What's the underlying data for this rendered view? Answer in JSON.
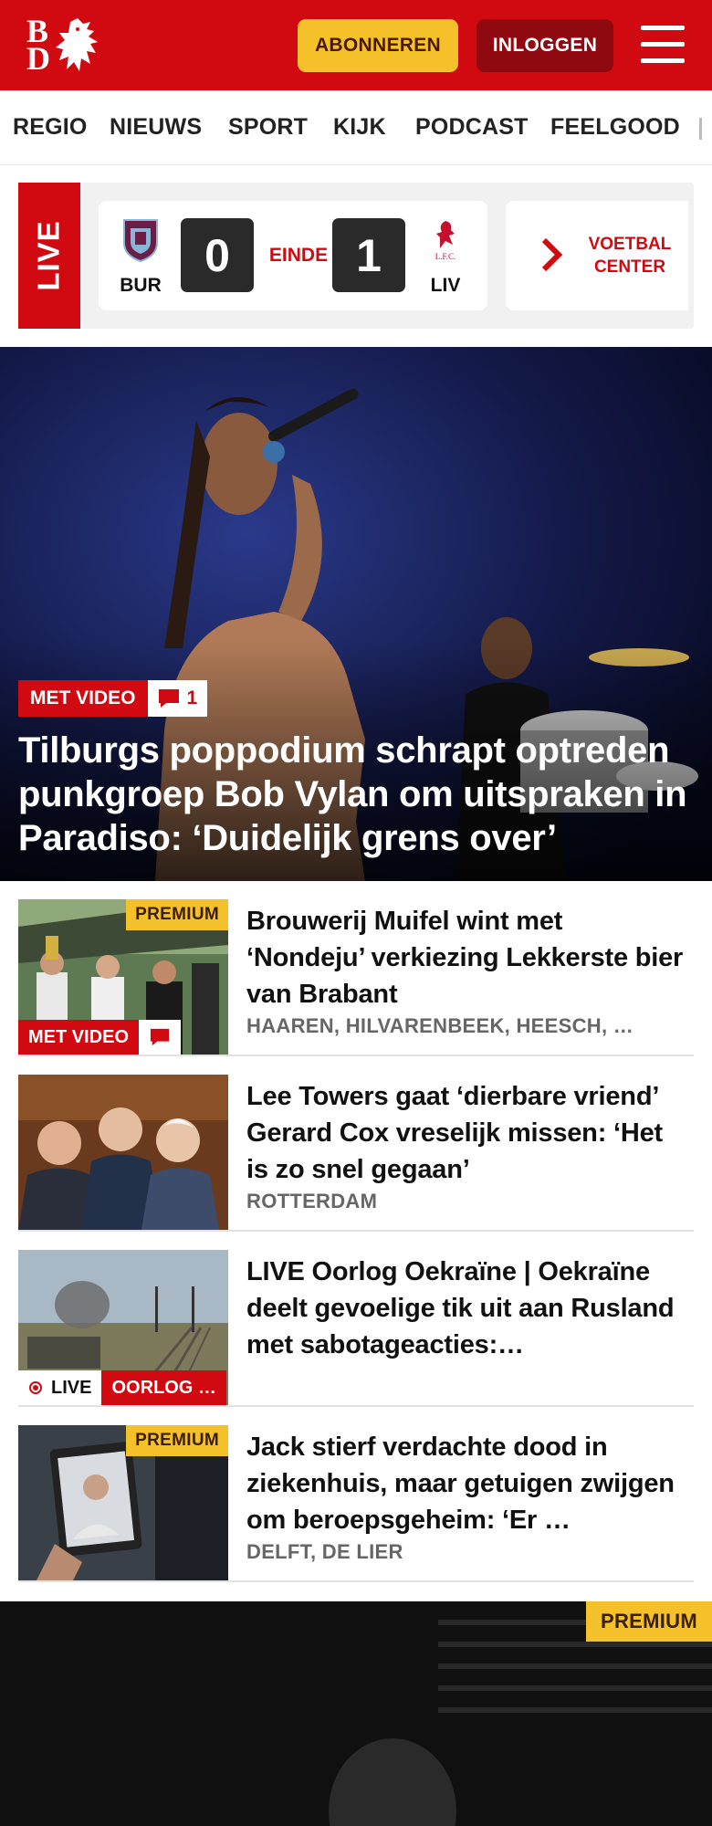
{
  "header": {
    "logo_b": "B",
    "logo_d": "D",
    "subscribe_label": "ABONNEREN",
    "login_label": "INLOGGEN",
    "brand_color": "#d10a11"
  },
  "nav": {
    "items": [
      "REGIO",
      "NIEUWS",
      "SPORT",
      "KIJK",
      "PODCAST",
      "FEELGOOD"
    ]
  },
  "live": {
    "tag": "LIVE",
    "home": {
      "abbr": "BUR",
      "score": "0"
    },
    "away": {
      "abbr": "LIV",
      "score": "1",
      "crest_text": "L.F.C."
    },
    "status": "EINDE",
    "voetbal_center_line1": "VOETBAL",
    "voetbal_center_line2": "CENTER"
  },
  "hero": {
    "badge_video": "MET VIDEO",
    "comment_count": "1",
    "title": "Tilburgs poppodium schrapt optreden punkgroep Bob Vylan om uitspraken in Paradiso: ‘Duidelijk grens over’"
  },
  "articles": [
    {
      "title": "Brouwerij Muifel wint met ‘Nondeju’ verkiezing Lekkerste bier van Brabant",
      "location": "HAAREN, HILVARENBEEK, HEESCH, …",
      "premium": "PREMIUM",
      "badge_video": "MET VIDEO"
    },
    {
      "title": "Lee Towers gaat ‘dierbare vriend’ Gerard Cox vreselijk missen: ‘Het is zo snel gegaan’",
      "location": "ROTTERDAM"
    },
    {
      "title": "LIVE Oorlog Oekraïne | Oekraïne deelt gevoelige tik uit aan Rusland met sabotageacties:…",
      "live_label": "LIVE",
      "category": "OORLOG …"
    },
    {
      "title": "Jack stierf verdachte dood in ziekenhuis, maar getuigen zwijgen om beroepsgeheim: ‘Er …",
      "location": "DELFT, DE LIER",
      "premium": "PREMIUM"
    }
  ],
  "bottom": {
    "premium": "PREMIUM"
  }
}
